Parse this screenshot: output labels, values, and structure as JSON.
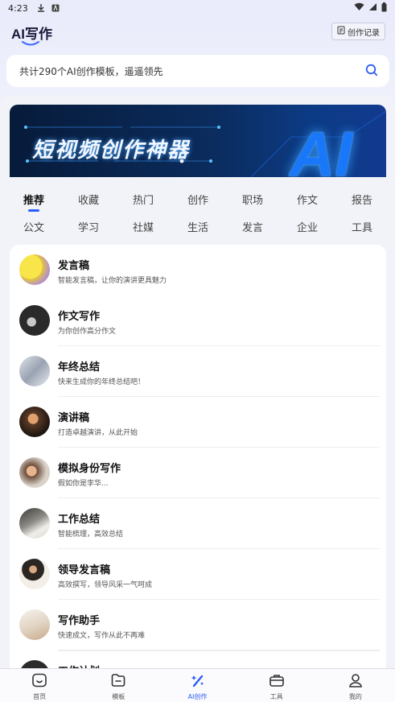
{
  "status": {
    "time": "4:23"
  },
  "header": {
    "logo": "AI写作",
    "history_label": "创作记录"
  },
  "search": {
    "text": "共计290个AI创作模板，遥遥领先"
  },
  "banner": {
    "title": "短视频创作神器",
    "ai": "AI"
  },
  "categories": {
    "row1": [
      "推荐",
      "收藏",
      "热门",
      "创作",
      "职场",
      "作文",
      "报告"
    ],
    "row2": [
      "公文",
      "学习",
      "社媒",
      "生活",
      "发言",
      "企业",
      "工具"
    ],
    "active": "推荐"
  },
  "templates": [
    {
      "title": "发言稿",
      "desc": "智能发言稿，让你的演讲更具魅力"
    },
    {
      "title": "作文写作",
      "desc": "为你创作高分作文"
    },
    {
      "title": "年终总结",
      "desc": "快来生成你的年终总结吧！"
    },
    {
      "title": "演讲稿",
      "desc": "打造卓越演讲，从此开始"
    },
    {
      "title": "模拟身份写作",
      "desc": "假如你是李华..."
    },
    {
      "title": "工作总结",
      "desc": "智能梳理，高效总结"
    },
    {
      "title": "领导发言稿",
      "desc": "高效撰写，领导风采一气呵成"
    },
    {
      "title": "写作助手",
      "desc": "快速成文，写作从此不再难"
    },
    {
      "title": "工作计划",
      "desc": ""
    }
  ],
  "nav": [
    {
      "label": "首页",
      "icon": "home-icon"
    },
    {
      "label": "模板",
      "icon": "folder-icon"
    },
    {
      "label": "AI创作",
      "icon": "magic-wand-icon"
    },
    {
      "label": "工具",
      "icon": "toolbox-icon"
    },
    {
      "label": "我的",
      "icon": "user-icon"
    }
  ],
  "colors": {
    "accent": "#2b5cf6",
    "banner_bg": "#0b2c5e"
  }
}
